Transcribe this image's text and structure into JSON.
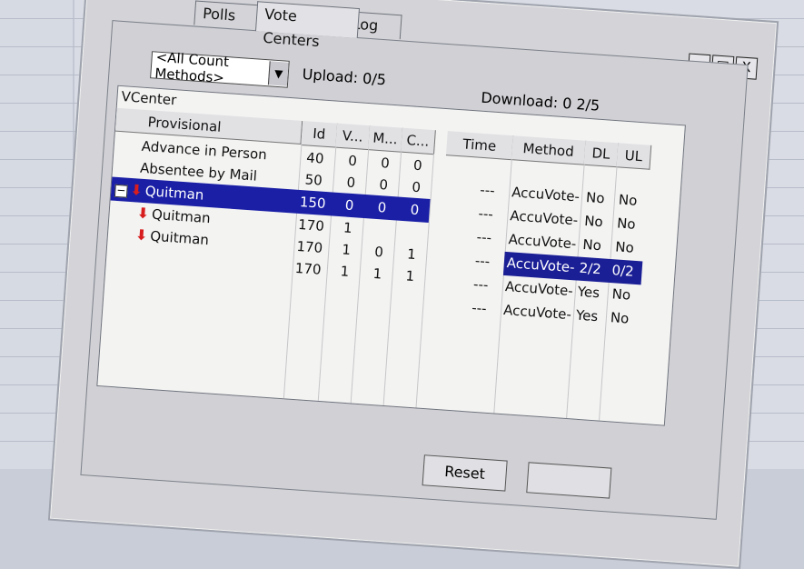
{
  "tabs": [
    {
      "label": "Polls"
    },
    {
      "label": "Vote Centers"
    },
    {
      "label": "Log"
    }
  ],
  "window_buttons": [
    "_",
    "□",
    "X"
  ],
  "dropdown": {
    "value": "<All Count Methods>",
    "arrow": "▼"
  },
  "upload": {
    "label": "Upload:",
    "value": "0/5"
  },
  "download": {
    "label": "Download:",
    "value": "0 2/5"
  },
  "table": {
    "title": "VCenter",
    "left_headers": [
      "Provisional",
      "Id",
      "V...",
      "M...",
      "C..."
    ],
    "right_headers": [
      "Time",
      "Method",
      "DL",
      "UL"
    ],
    "left_rows": [
      {
        "name": "Advance in Person",
        "id": "40",
        "v": "0",
        "m": "0",
        "c": "0"
      },
      {
        "name": "Absentee by Mail",
        "id": "50",
        "v": "0",
        "m": "0",
        "c": "0"
      },
      {
        "name": "Quitman",
        "id": "150",
        "v": "0",
        "m": "0",
        "c": "0"
      },
      {
        "name": "Quitman",
        "id": "170",
        "v": "1",
        "m": "",
        "c": ""
      },
      {
        "name": "Quitman",
        "id": "170",
        "v": "1",
        "m": "0",
        "c": "1"
      },
      {
        "name": "",
        "id": "170",
        "v": "1",
        "m": "1",
        "c": "1"
      }
    ],
    "right_rows": [
      {
        "time": "---",
        "method": "AccuVote-",
        "dl": "No",
        "ul": "No"
      },
      {
        "time": "---",
        "method": "AccuVote-",
        "dl": "No",
        "ul": "No"
      },
      {
        "time": "---",
        "method": "AccuVote-",
        "dl": "No",
        "ul": "No"
      },
      {
        "time": "---",
        "method": "AccuVote-",
        "dl": "2/2",
        "ul": "0/2"
      },
      {
        "time": "---",
        "method": "AccuVote-",
        "dl": "Yes",
        "ul": "No"
      },
      {
        "time": "---",
        "method": "AccuVote-",
        "dl": "Yes",
        "ul": "No"
      }
    ]
  },
  "buttons": {
    "reset": "Reset",
    "other": ""
  }
}
